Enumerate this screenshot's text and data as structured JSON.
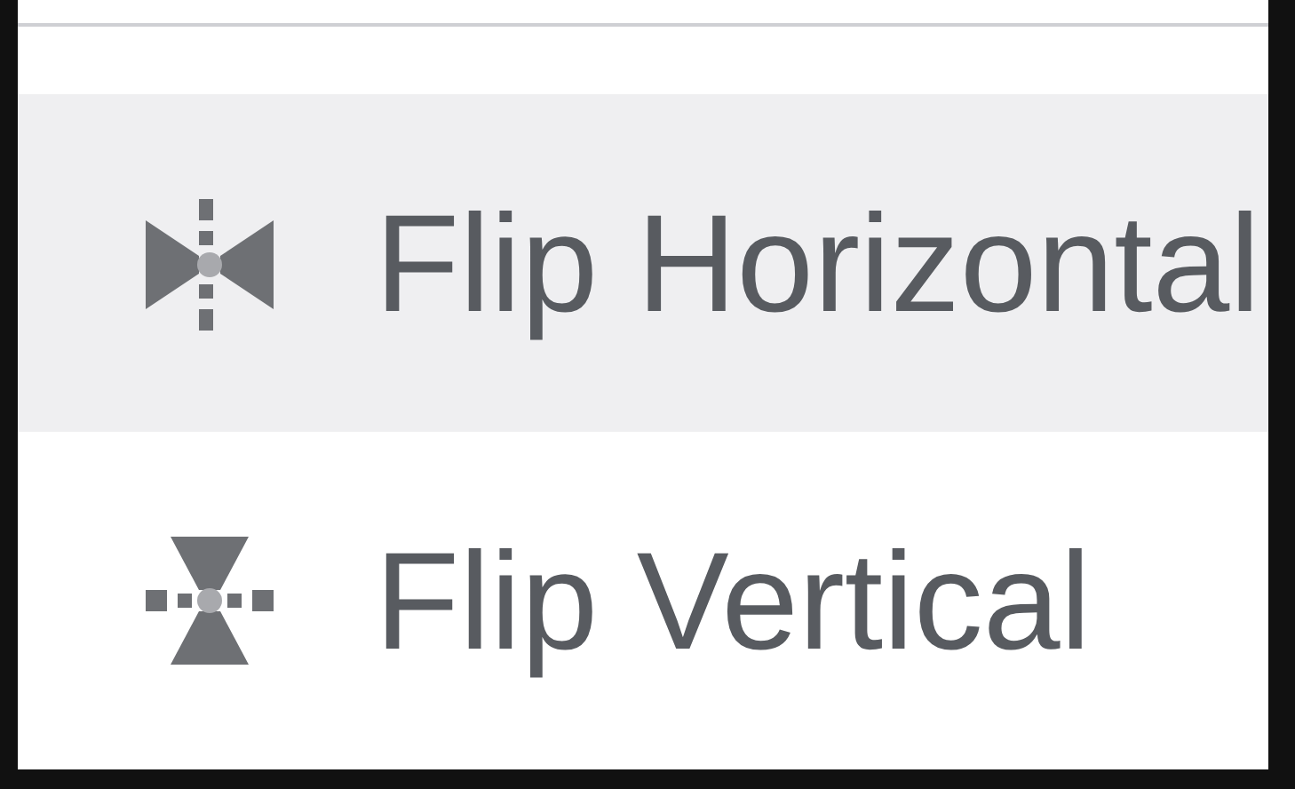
{
  "menu": {
    "items": [
      {
        "kind": "flip-horizontal",
        "label": "Flip Horizontal",
        "selected": true
      },
      {
        "kind": "flip-vertical",
        "label": "Flip Vertical",
        "selected": false
      }
    ]
  }
}
